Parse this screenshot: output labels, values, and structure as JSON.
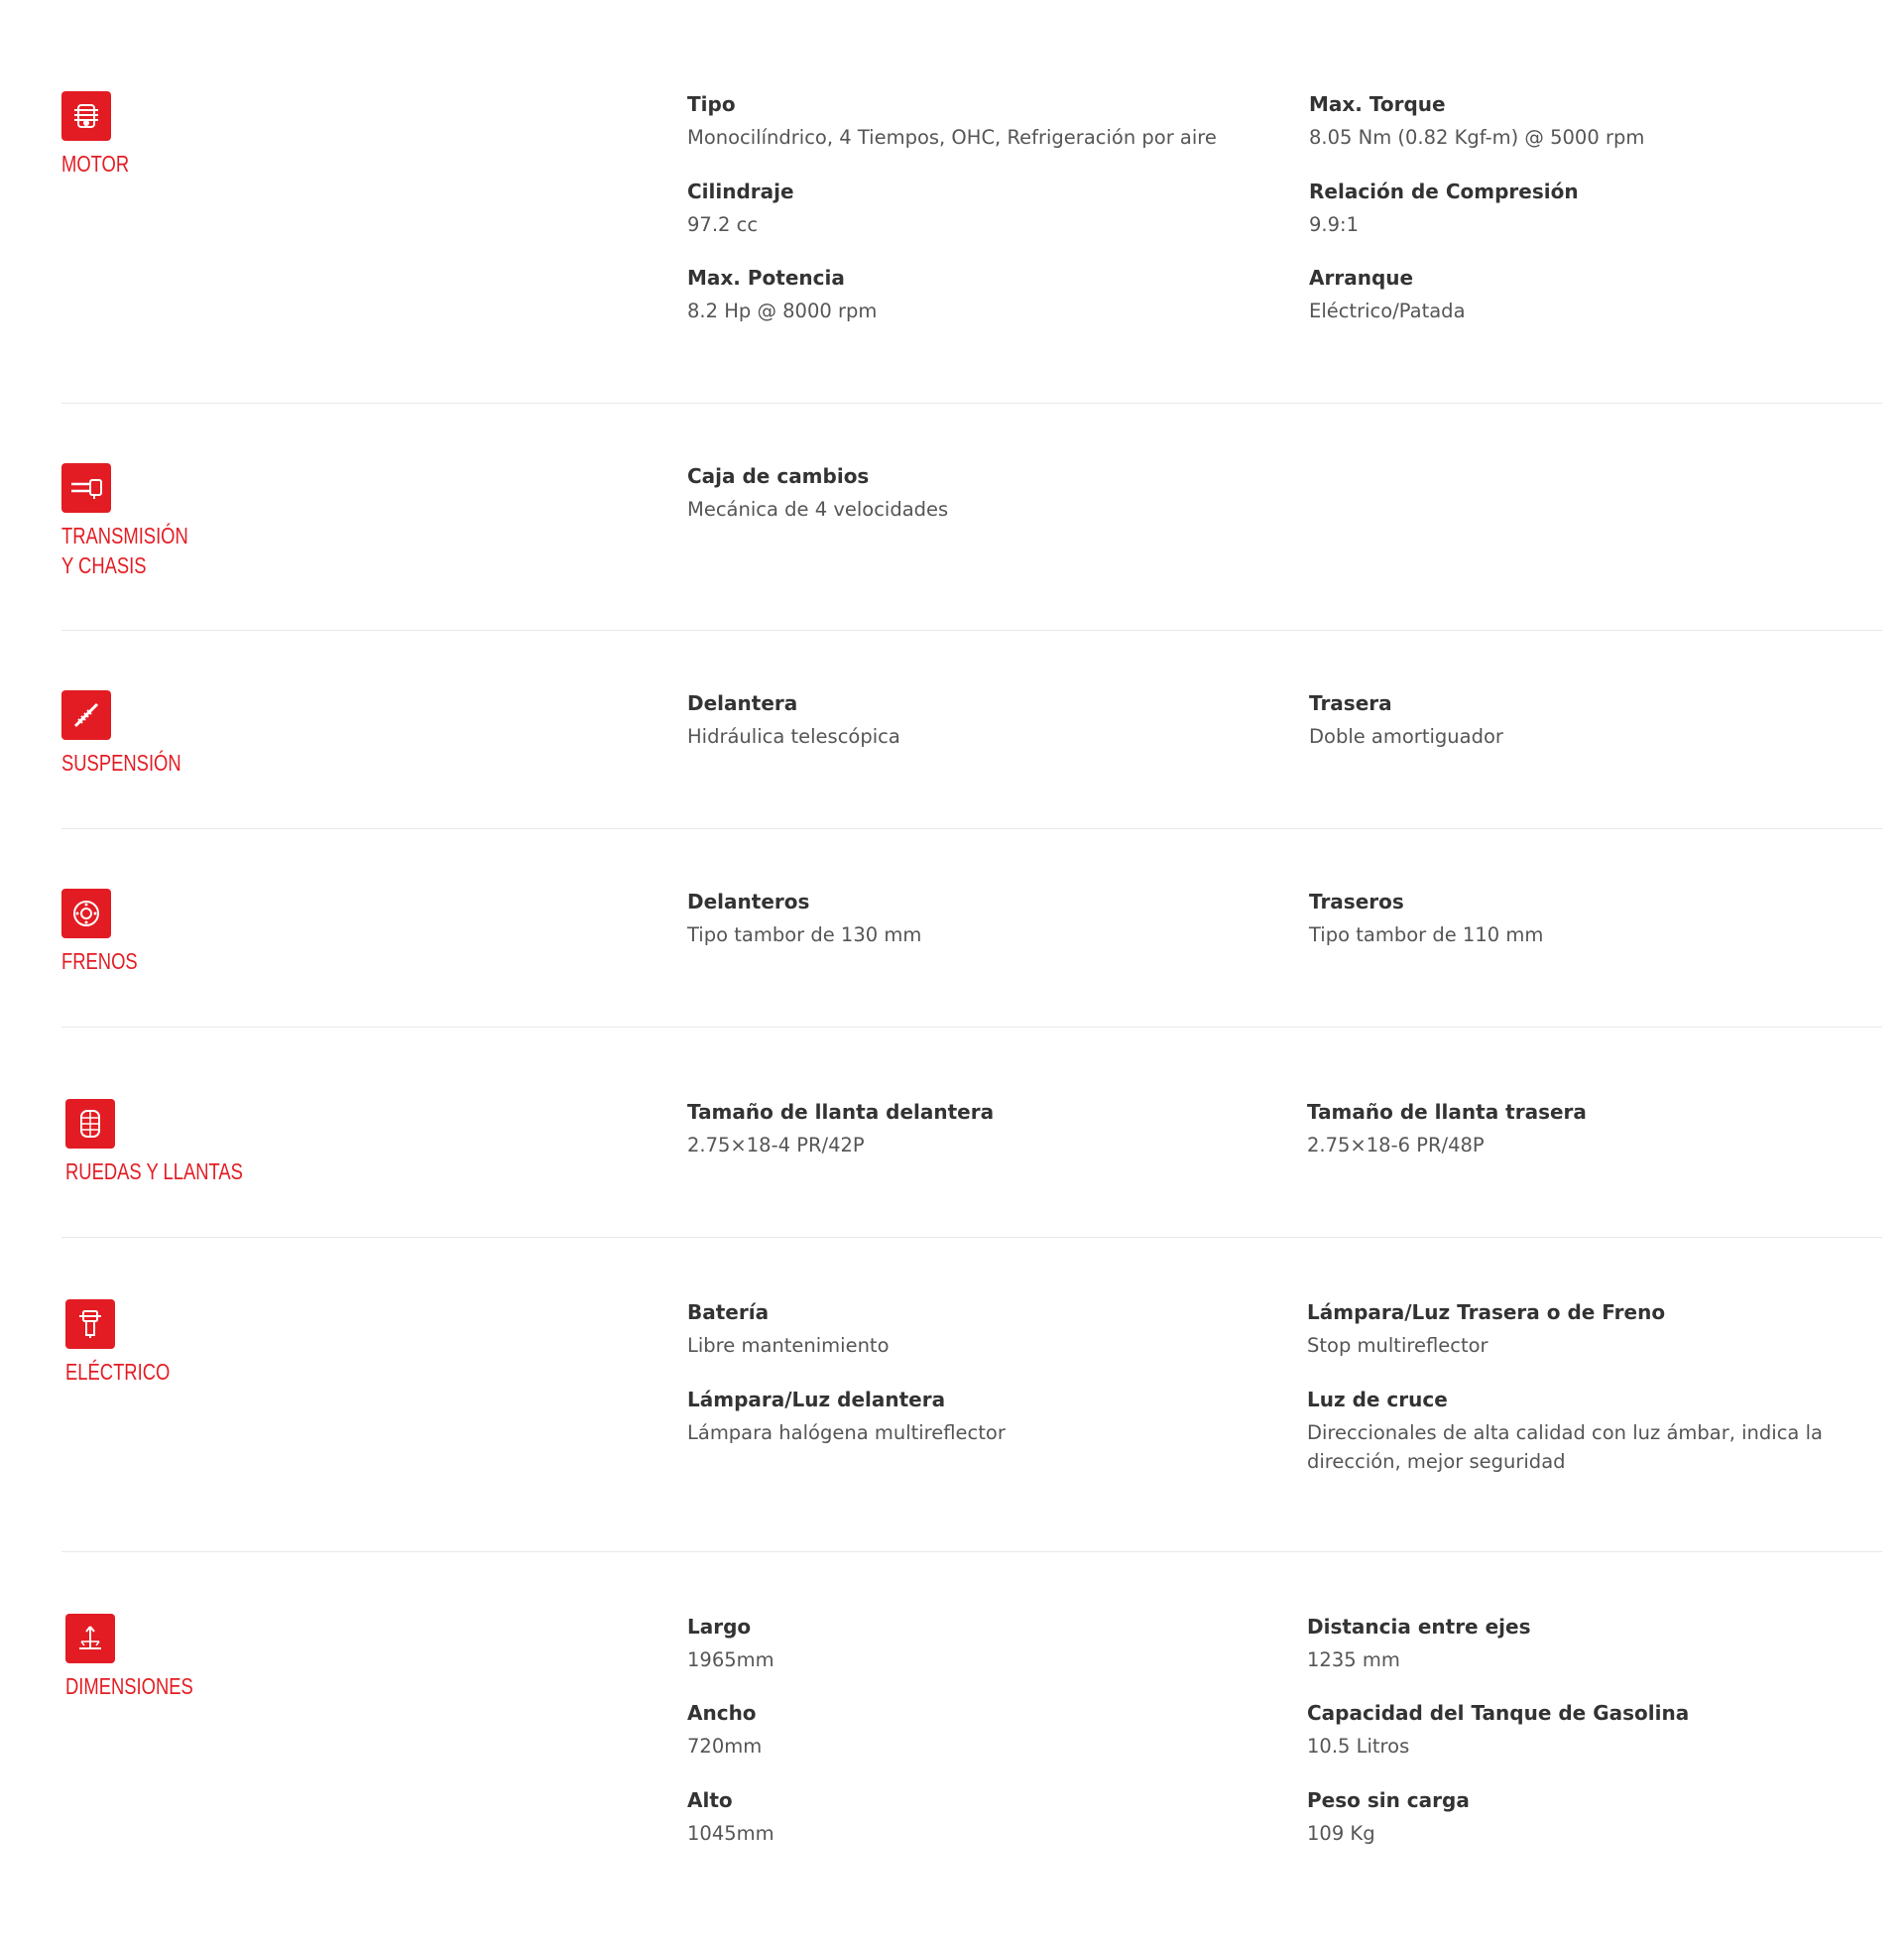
{
  "colors": {
    "accent": "#e31c23",
    "text": "#333333",
    "muted": "#555555",
    "divider": "#e8e8e8"
  },
  "sections": [
    {
      "id": "motor",
      "icon": "engine-icon",
      "label_lines": [
        "MOTOR"
      ],
      "specs": [
        {
          "label": "Tipo",
          "value": "Monocilíndrico, 4 Tiempos, OHC, Refrigeración por aire"
        },
        {
          "label": "Max. Torque",
          "value": "8.05 Nm (0.82 Kgf-m) @ 5000 rpm"
        },
        {
          "label": "Cilindraje",
          "value": "97.2 cc"
        },
        {
          "label": "Relación de Compresión",
          "value": "9.9:1"
        },
        {
          "label": "Max. Potencia",
          "value": "8.2 Hp @ 8000 rpm"
        },
        {
          "label": "Arranque",
          "value": "Eléctrico/Patada"
        }
      ]
    },
    {
      "id": "transmision",
      "icon": "transmission-icon",
      "label_lines": [
        "TRANSMISIÓN",
        "Y CHASIS"
      ],
      "specs": [
        {
          "label": "Caja de cambios",
          "value": "Mecánica de 4 velocidades"
        }
      ]
    },
    {
      "id": "suspension",
      "icon": "suspension-icon",
      "label_lines": [
        "SUSPENSIÓN"
      ],
      "specs": [
        {
          "label": "Delantera",
          "value": "Hidráulica telescópica"
        },
        {
          "label": "Trasera",
          "value": "Doble amortiguador"
        }
      ]
    },
    {
      "id": "frenos",
      "icon": "brake-disc-icon",
      "label_lines": [
        "FRENOS"
      ],
      "specs": [
        {
          "label": "Delanteros",
          "value": "Tipo tambor de 130 mm"
        },
        {
          "label": "Traseros",
          "value": "Tipo tambor de 110 mm"
        }
      ]
    },
    {
      "id": "ruedas",
      "icon": "tire-icon",
      "label_lines": [
        "RUEDAS Y LLANTAS"
      ],
      "specs": [
        {
          "label": "Tamaño de llanta delantera",
          "value": "2.75×18-4 PR/42P"
        },
        {
          "label": "Tamaño de llanta trasera",
          "value": "2.75×18-6 PR/48P"
        }
      ]
    },
    {
      "id": "electrico",
      "icon": "electrical-icon",
      "label_lines": [
        "ELÉCTRICO"
      ],
      "specs": [
        {
          "label": "Batería",
          "value": "Libre mantenimiento"
        },
        {
          "label": "Lámpara/Luz Trasera o de Freno",
          "value": "Stop multireflector"
        },
        {
          "label": "Lámpara/Luz delantera",
          "value": "Lámpara halógena multireflector"
        },
        {
          "label": "Luz de cruce",
          "value": "Direccionales de alta calidad con luz ámbar, indica la dirección, mejor seguridad"
        }
      ]
    },
    {
      "id": "dimensiones",
      "icon": "dimensions-icon",
      "label_lines": [
        "DIMENSIONES"
      ],
      "specs": [
        {
          "label": "Largo",
          "value": "1965mm"
        },
        {
          "label": "Distancia entre ejes",
          "value": "1235 mm"
        },
        {
          "label": "Ancho",
          "value": "720mm"
        },
        {
          "label": "Capacidad del Tanque de Gasolina",
          "value": "10.5 Litros"
        },
        {
          "label": "Alto",
          "value": "1045mm"
        },
        {
          "label": "Peso sin carga",
          "value": "109 Kg"
        }
      ]
    }
  ]
}
